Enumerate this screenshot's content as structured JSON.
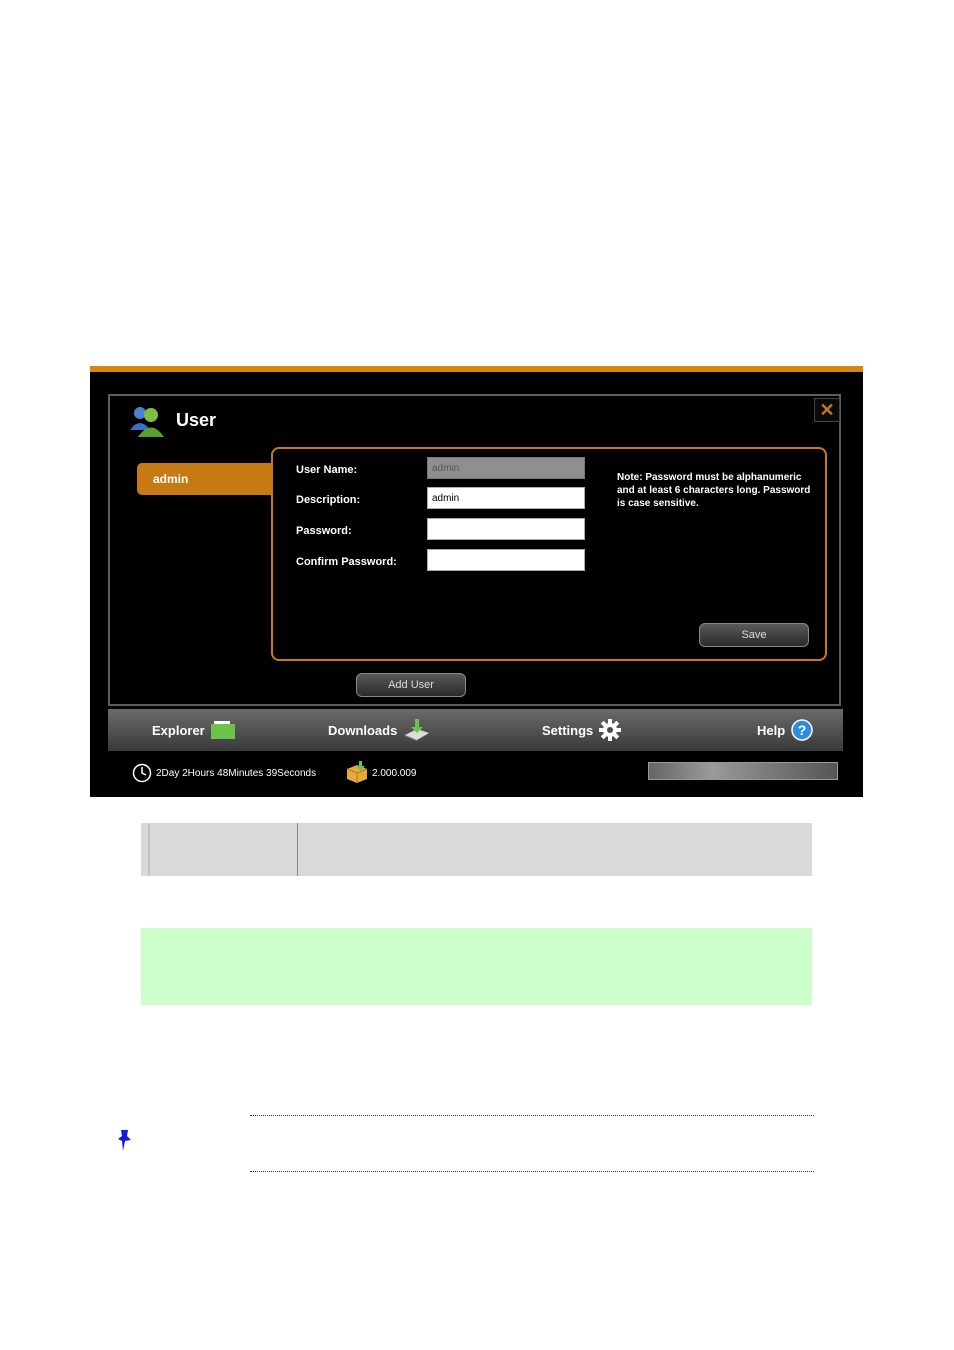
{
  "dialog": {
    "title": "User",
    "close_label": "✕"
  },
  "user_list": [
    {
      "label": "admin"
    }
  ],
  "form": {
    "username_label": "User Name:",
    "username_value": "admin",
    "description_label": "Description:",
    "description_value": "admin",
    "password_label": "Password:",
    "password_value": "",
    "confirm_label": "Confirm Password:",
    "confirm_value": "",
    "note": "Note: Password must be alphanumeric and at least 6 characters long. Password is case sensitive.",
    "save_label": "Save"
  },
  "add_user_label": "Add User",
  "nav": {
    "explorer": "Explorer",
    "downloads": "Downloads",
    "settings": "Settings",
    "help": "Help"
  },
  "status": {
    "uptime": "2Day 2Hours 48Minutes 39Seconds",
    "version": "2.000.009"
  },
  "colors": {
    "accent": "#c77a14",
    "topbar": "#d4860f",
    "green_panel": "#ccffcc",
    "gray_panel": "#d9d9d9"
  }
}
